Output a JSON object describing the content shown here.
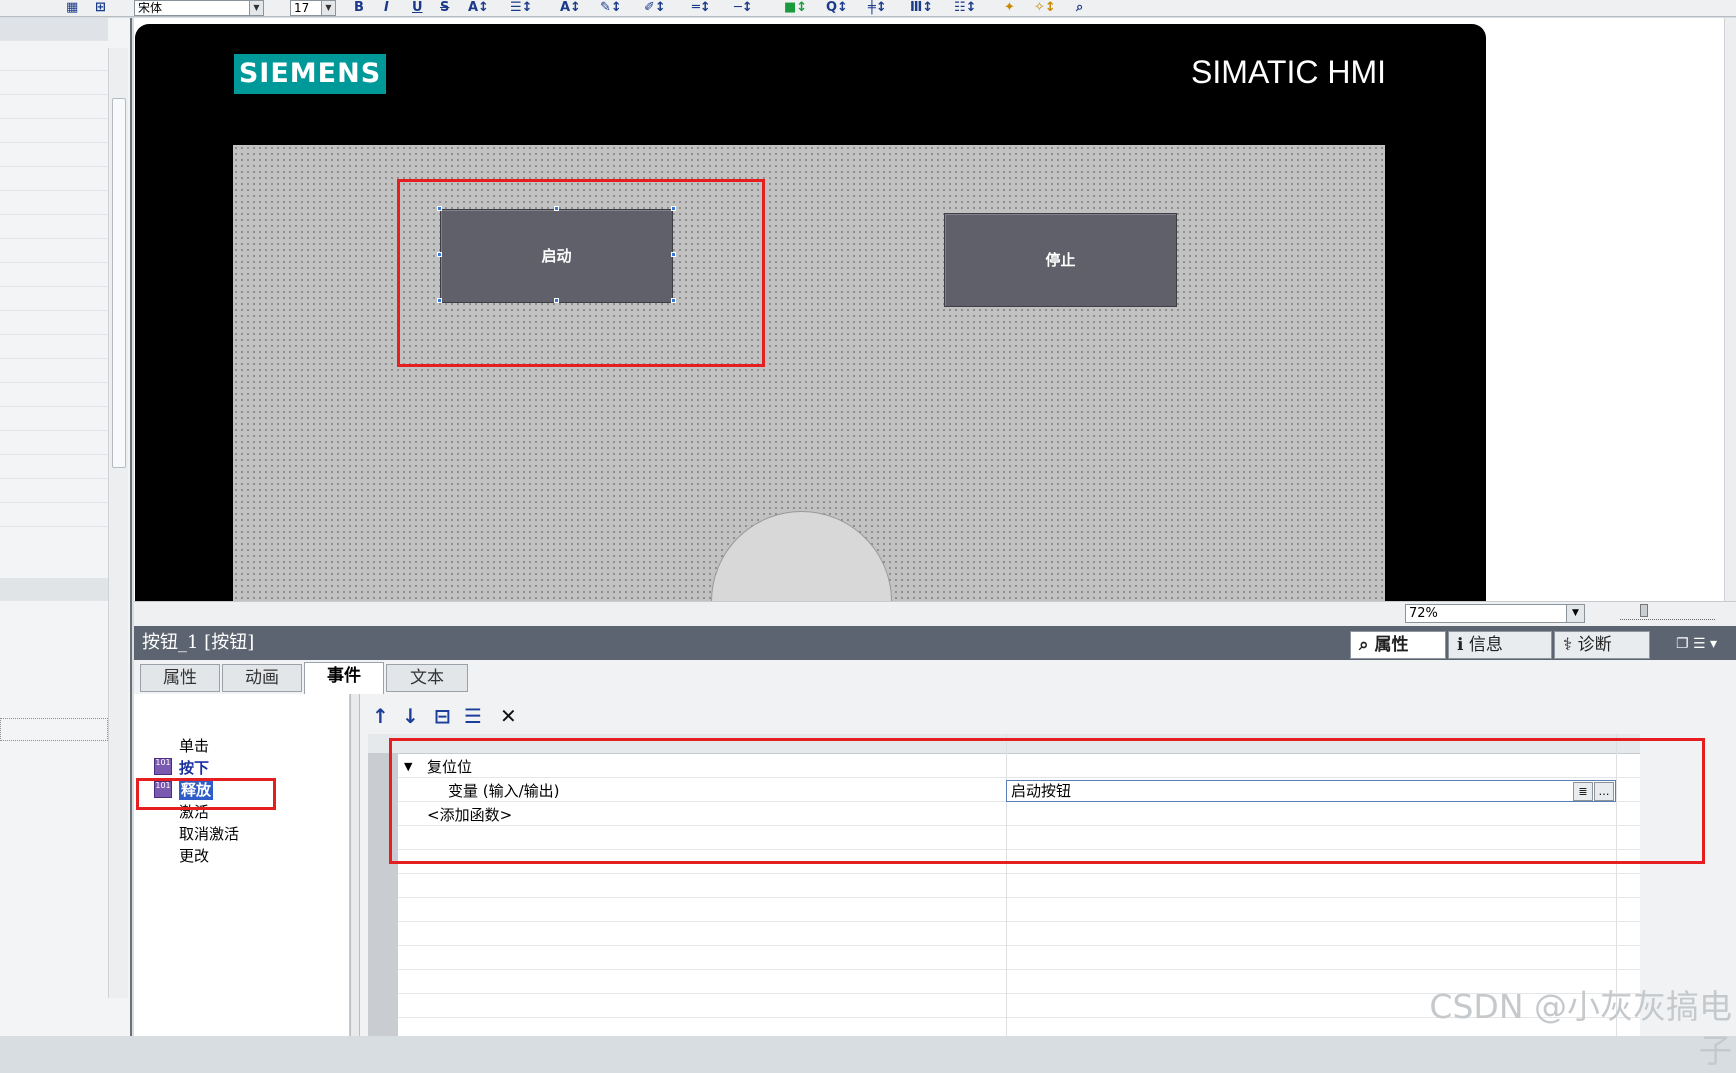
{
  "toolbar": {
    "font_name": "宋体",
    "font_size": "17",
    "bold": "B",
    "italic": "I",
    "underline": "U",
    "strike": "S"
  },
  "hmi": {
    "brand": "SIEMENS",
    "title": "SIMATIC HMI",
    "start_button": "启动",
    "stop_button": "停止"
  },
  "zoom": {
    "value": "72%"
  },
  "inspector": {
    "title": "按钮_1 [按钮]",
    "right_tabs": [
      {
        "label": "属性"
      },
      {
        "label": "信息"
      },
      {
        "label": "诊断"
      }
    ],
    "tabs": [
      {
        "label": "属性"
      },
      {
        "label": "动画"
      },
      {
        "label": "事件"
      },
      {
        "label": "文本"
      }
    ],
    "events": [
      {
        "label": "单击"
      },
      {
        "label": "按下"
      },
      {
        "label": "释放"
      },
      {
        "label": "激活"
      },
      {
        "label": "取消激活"
      },
      {
        "label": "更改"
      }
    ],
    "function_name": "复位位",
    "param_label": "变量 (输入/输出)",
    "param_value": "启动按钮",
    "add_function": "<添加函数>"
  },
  "watermark": "CSDN @小灰灰搞电子",
  "colors": {
    "siemens_teal": "#009999",
    "highlight_red": "#e51f1f",
    "button_gray": "#5f6069"
  }
}
